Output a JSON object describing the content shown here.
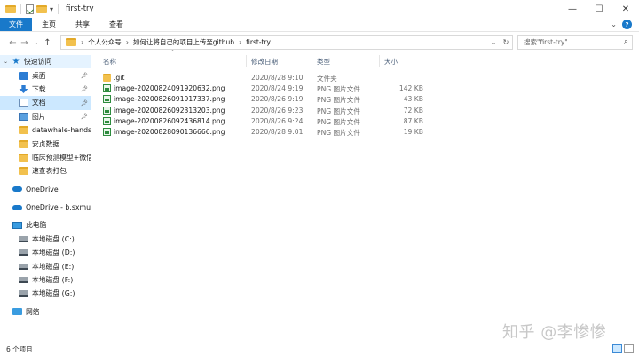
{
  "window": {
    "title": "first-try",
    "controls": [
      "—",
      "☐",
      "✕"
    ]
  },
  "ribbon": {
    "tabs": [
      "文件",
      "主页",
      "共享",
      "查看"
    ]
  },
  "address": {
    "breadcrumb": [
      "个人公众号",
      "如何让将自己的项目上传至github",
      "first-try"
    ]
  },
  "search": {
    "placeholder": "搜索\"first-try\""
  },
  "nav": {
    "quick_access": "快速访问",
    "items": [
      {
        "label": "桌面",
        "icon": "desktop-icon",
        "pinned": true
      },
      {
        "label": "下载",
        "icon": "download-icon",
        "pinned": true
      },
      {
        "label": "文档",
        "icon": "documents-icon",
        "pinned": true
      },
      {
        "label": "图片",
        "icon": "pictures-icon",
        "pinned": true
      },
      {
        "label": "datawhale-hands-",
        "icon": "folder-icon",
        "pinned": false
      },
      {
        "label": "安贞数据",
        "icon": "folder-icon",
        "pinned": false
      },
      {
        "label": "临床预测模型+微信",
        "icon": "folder-icon",
        "pinned": false
      },
      {
        "label": "速查表打包",
        "icon": "folder-icon",
        "pinned": false
      }
    ],
    "onedrive": "OneDrive",
    "onedrive_business": "OneDrive - b.sxmu.",
    "this_pc": "此电脑",
    "drives": [
      "本地磁盘 (C:)",
      "本地磁盘 (D:)",
      "本地磁盘 (E:)",
      "本地磁盘 (F:)",
      "本地磁盘 (G:)"
    ],
    "network": "网络"
  },
  "columns": {
    "name": "名称",
    "date": "修改日期",
    "type": "类型",
    "size": "大小"
  },
  "files": [
    {
      "name": ".git",
      "date": "2020/8/28 9:10",
      "type": "文件夹",
      "size": "",
      "icon": "folder-icon"
    },
    {
      "name": "image-20200824091920632.png",
      "date": "2020/8/24 9:19",
      "type": "PNG 图片文件",
      "size": "142 KB",
      "icon": "png-file-icon"
    },
    {
      "name": "image-20200826091917337.png",
      "date": "2020/8/26 9:19",
      "type": "PNG 图片文件",
      "size": "43 KB",
      "icon": "png-file-icon"
    },
    {
      "name": "image-20200826092313203.png",
      "date": "2020/8/26 9:23",
      "type": "PNG 图片文件",
      "size": "72 KB",
      "icon": "png-file-icon"
    },
    {
      "name": "image-20200826092436814.png",
      "date": "2020/8/26 9:24",
      "type": "PNG 图片文件",
      "size": "87 KB",
      "icon": "png-file-icon"
    },
    {
      "name": "image-20200828090136666.png",
      "date": "2020/8/28 9:01",
      "type": "PNG 图片文件",
      "size": "19 KB",
      "icon": "png-file-icon"
    }
  ],
  "status": {
    "count": "6 个项目"
  },
  "watermark": "知乎 @李惨惨",
  "colors": {
    "accent": "#1979ca",
    "selection": "#cce8ff"
  }
}
